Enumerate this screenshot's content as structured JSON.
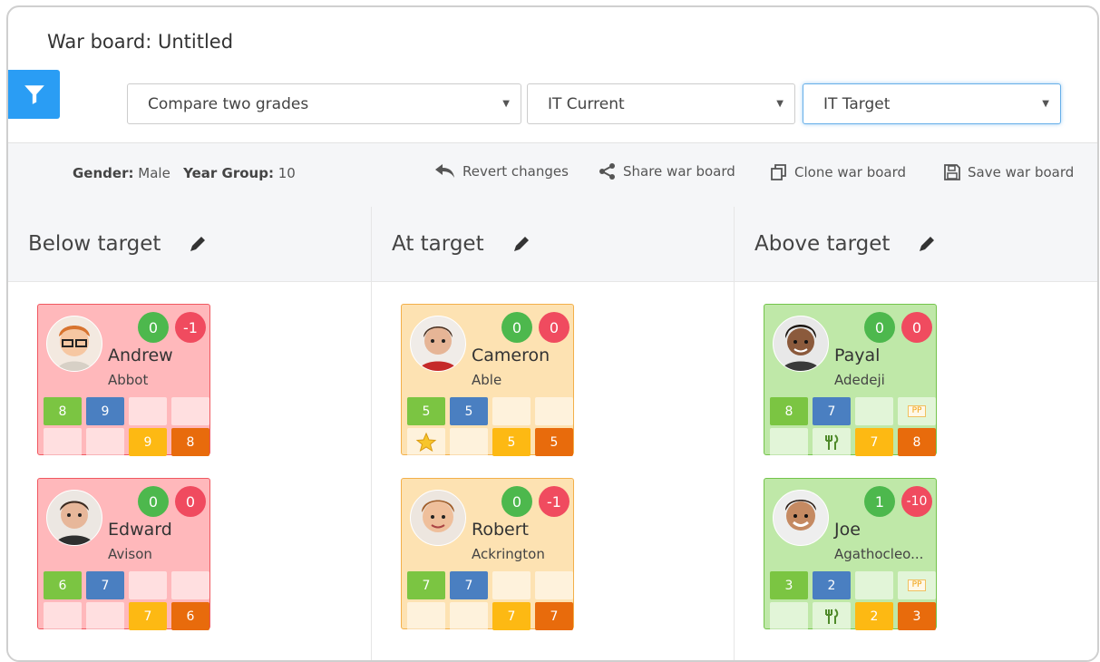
{
  "header": {
    "title": "War board: Untitled"
  },
  "filters": {
    "mode": "Compare two grades",
    "grade_a": "IT Current",
    "grade_b": "IT Target"
  },
  "meta": {
    "gender_label": "Gender:",
    "gender_value": "Male",
    "year_label": "Year Group:",
    "year_value": "10"
  },
  "actions": {
    "revert": "Revert changes",
    "share": "Share war board",
    "clone": "Clone war board",
    "save": "Save war board"
  },
  "columns": [
    {
      "title": "Below target",
      "cards": [
        {
          "first": "Andrew",
          "last": "Abbot",
          "left_badge": "0",
          "right_badge": "-1",
          "right_color": "red",
          "t1": "8",
          "t2": "9",
          "t3": "9",
          "t4": "8",
          "star": false,
          "pp": false,
          "fork": false
        },
        {
          "first": "Edward",
          "last": "Avison",
          "left_badge": "0",
          "right_badge": "0",
          "right_color": "red",
          "t1": "6",
          "t2": "7",
          "t3": "7",
          "t4": "6",
          "star": false,
          "pp": false,
          "fork": false
        }
      ]
    },
    {
      "title": "At target",
      "cards": [
        {
          "first": "Cameron",
          "last": "Able",
          "left_badge": "0",
          "right_badge": "0",
          "right_color": "red",
          "t1": "5",
          "t2": "5",
          "t3": "5",
          "t4": "5",
          "star": true,
          "pp": false,
          "fork": false
        },
        {
          "first": "Robert",
          "last": "Ackrington",
          "left_badge": "0",
          "right_badge": "-1",
          "right_color": "red",
          "t1": "7",
          "t2": "7",
          "t3": "7",
          "t4": "7",
          "star": false,
          "pp": false,
          "fork": false
        }
      ]
    },
    {
      "title": "Above target",
      "cards": [
        {
          "first": "Payal",
          "last": "Adedeji",
          "left_badge": "0",
          "right_badge": "0",
          "right_color": "red",
          "t1": "8",
          "t2": "7",
          "t3": "7",
          "t4": "8",
          "star": false,
          "pp": true,
          "fork": true
        },
        {
          "first": "Joe",
          "last": "Agathocleo...",
          "left_badge": "1",
          "right_badge": "-10",
          "right_color": "red",
          "t1": "3",
          "t2": "2",
          "t3": "2",
          "t4": "3",
          "star": false,
          "pp": true,
          "fork": true
        }
      ]
    }
  ],
  "colors": {
    "accent": "#2a9df4",
    "below": "#ffb8bb",
    "at": "#fde2b2",
    "above": "#bfe8a8"
  },
  "icons": [
    "filter-icon",
    "undo-icon",
    "share-icon",
    "clone-icon",
    "save-icon",
    "pencil-icon",
    "star-icon",
    "fork-knife-icon",
    "pp-badge-icon"
  ]
}
